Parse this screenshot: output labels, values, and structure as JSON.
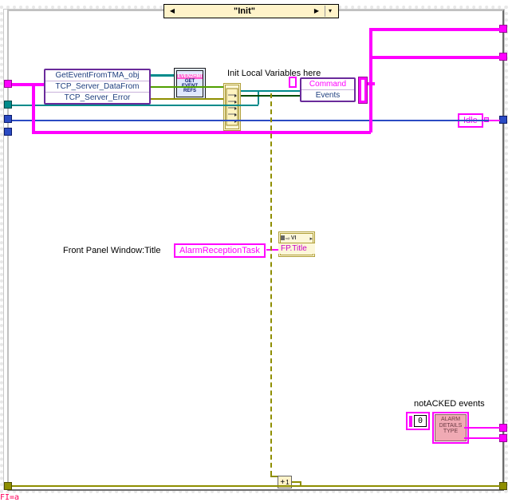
{
  "case_selector": {
    "value": "\"Init\""
  },
  "unbundle": {
    "rows": [
      "GetEventFromTMA_obj",
      "TCP_Server_DataFrom",
      "TCP_Server_Error"
    ]
  },
  "subvi_get_event": {
    "line1": "EVEN2HMI",
    "line2": "GET",
    "line3": "EVENT",
    "line4": "REFS"
  },
  "comment_init": "Init Local Variables here",
  "bundle_right": {
    "rows": [
      "Command",
      "Events"
    ]
  },
  "idle_const": "Idle",
  "fp_label": "Front Panel Window:Title",
  "fp_const": "AlarmReceptionTask",
  "fp_property": "FP.Title",
  "inc_node": {
    "left": "+",
    "right": "1"
  },
  "not_acked": {
    "label": "notACKED events",
    "value": "0"
  },
  "alarm_icon": {
    "l1": "ALARM",
    "l2": "DETAILS",
    "l3": "TYPE"
  },
  "corner_flag": "FI=a"
}
